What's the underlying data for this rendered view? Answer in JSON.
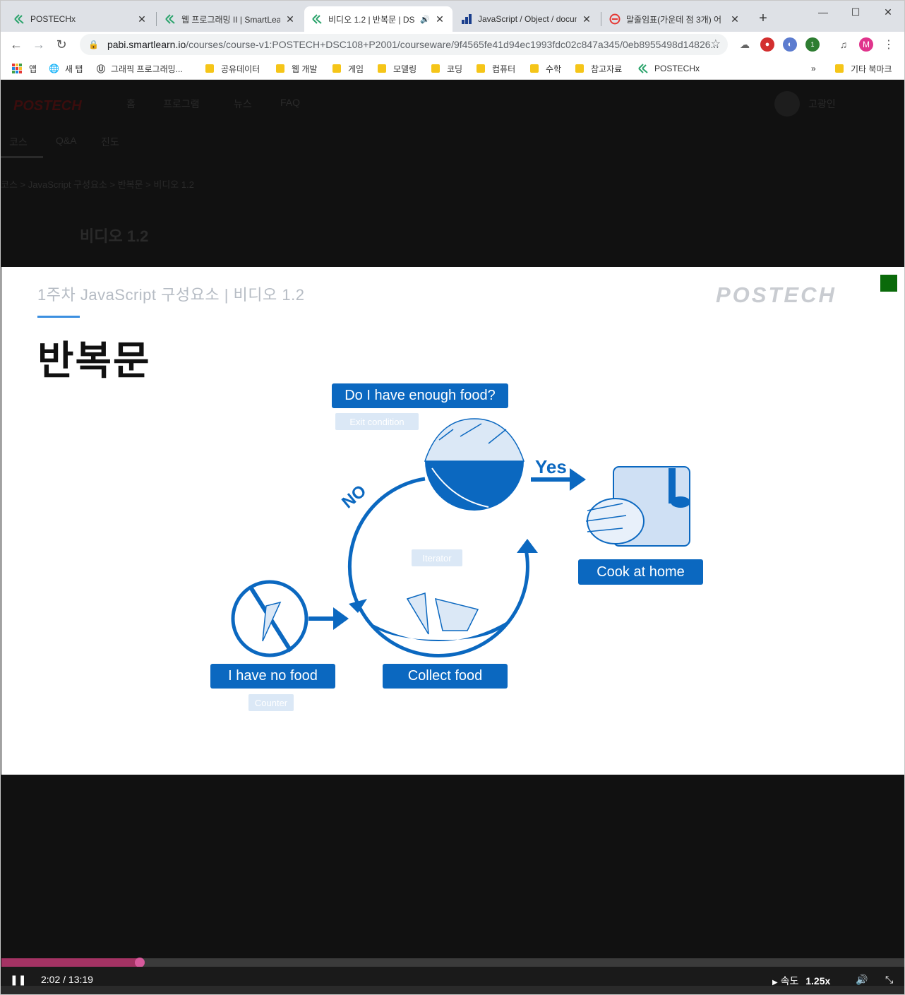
{
  "browser": {
    "tabs": [
      {
        "title": "POSTECHx",
        "icon": "edx-icon"
      },
      {
        "title": "웹 프로그래밍 II | SmartLearn",
        "icon": "edx-icon"
      },
      {
        "title": "비디오 1.2 | 반복문 | DS",
        "icon": "edx-icon",
        "active": true
      },
      {
        "title": "JavaScript / Object / document",
        "icon": "chart-icon"
      },
      {
        "title": "말줄임표(가운데 점 3개) 어",
        "icon": "no-entry-icon"
      }
    ],
    "url_host": "pabi.smartlearn.io",
    "url_path": "/courses/course-v1:POSTECH+DSC108+P2001/courseware/9f4565fe41d94ec1993fdc02c847a345/0eb8955498d14826...",
    "profile_initial": "M",
    "extension_badge": "1"
  },
  "bookmarks": {
    "items": [
      "앱",
      "새 탭",
      "그래픽 프로그래밍...",
      "공유데이터",
      "웹 개발",
      "게임",
      "모델링",
      "코딩",
      "컴퓨터",
      "수학",
      "참고자료",
      "POSTECHx"
    ],
    "more": "»",
    "other": "기타 북마크"
  },
  "site": {
    "logo": "POSTECH",
    "nav": [
      "홈",
      "프로그램",
      "뉴스",
      "FAQ"
    ],
    "user": "고광인",
    "subnav": [
      "코스",
      "Q&A",
      "진도"
    ],
    "breadcrumb": "코스  >  JavaScript 구성요소  >  반복문  >  비디오 1.2",
    "unit_title": "비디오 1.2"
  },
  "slide": {
    "header": "1주차 JavaScript 구성요소  |  비디오 1.2",
    "logo": "POSTECH",
    "title": "반복문",
    "question": "Do I have enough food?",
    "exit_condition": "Exit condition",
    "yes": "Yes",
    "no": "NO",
    "iterator": "Iterator",
    "cook": "Cook at home",
    "no_food": "I have no food",
    "counter": "Counter",
    "collect": "Collect food"
  },
  "player": {
    "time": "2:02 / 13:19",
    "progress": 0.153,
    "speed_label": "속도",
    "speed_value": "1.25x"
  }
}
